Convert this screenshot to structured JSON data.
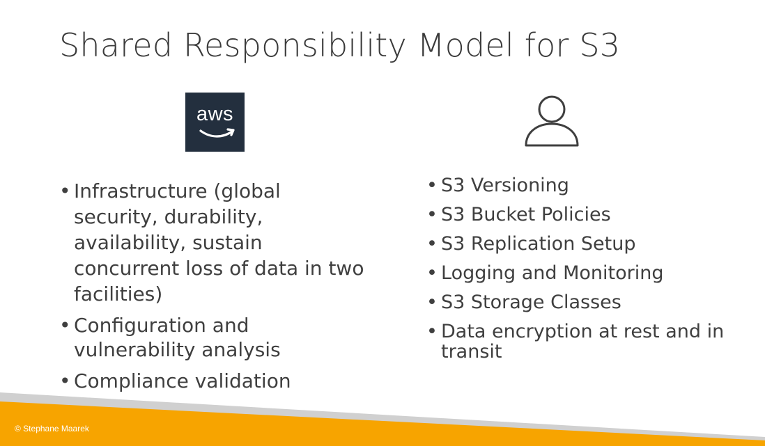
{
  "slide": {
    "title": "Shared Responsibility Model for S3"
  },
  "left": {
    "logo_text": "aws",
    "items": [
      "Infrastructure (global security, durability, availability, sustain concurrent loss of data in two facilities)",
      "Configuration and vulnerability analysis",
      "Compliance validation"
    ]
  },
  "right": {
    "icon": "user-icon",
    "items": [
      "S3 Versioning",
      "S3 Bucket Policies",
      "S3 Replication Setup",
      "Logging and Monitoring",
      "S3 Storage Classes",
      "Data encryption at rest and in transit"
    ]
  },
  "footer": {
    "copyright": "© Stephane Maarek"
  },
  "colors": {
    "text": "#3f3f3f",
    "aws_dark": "#232f3e",
    "orange": "#f7a400",
    "stripe_gray": "#d0d0d0",
    "white": "#ffffff"
  }
}
